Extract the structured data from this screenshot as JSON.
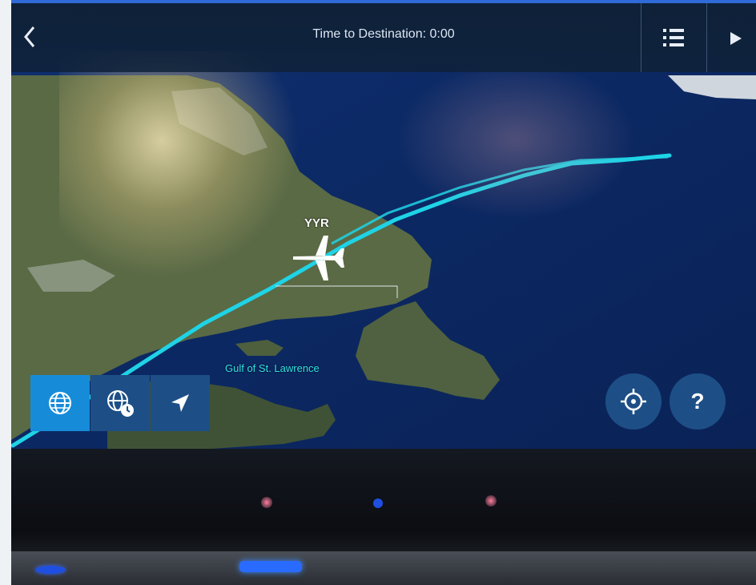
{
  "header": {
    "title": "Time to Destination: 0:00",
    "back_icon": "chevron-left-icon",
    "menu_icon": "list-icon",
    "play_icon": "play-icon"
  },
  "map": {
    "airport_code": "YYR",
    "region_label": "Gulf of St. Lawrence",
    "route_color": "#1fd3e6",
    "aircraft_icon": "airplane-icon"
  },
  "controls": {
    "view_buttons": [
      {
        "icon": "globe-icon",
        "active": true
      },
      {
        "icon": "globe-clock-icon",
        "active": false
      },
      {
        "icon": "navigation-arrow-icon",
        "active": false
      }
    ],
    "center_icon": "crosshair-icon",
    "help_label": "?"
  },
  "colors": {
    "accent": "#168cd9",
    "button_bg": "#1d4f86",
    "header_bg": "#0f2138",
    "ocean": "#0d2a66"
  }
}
